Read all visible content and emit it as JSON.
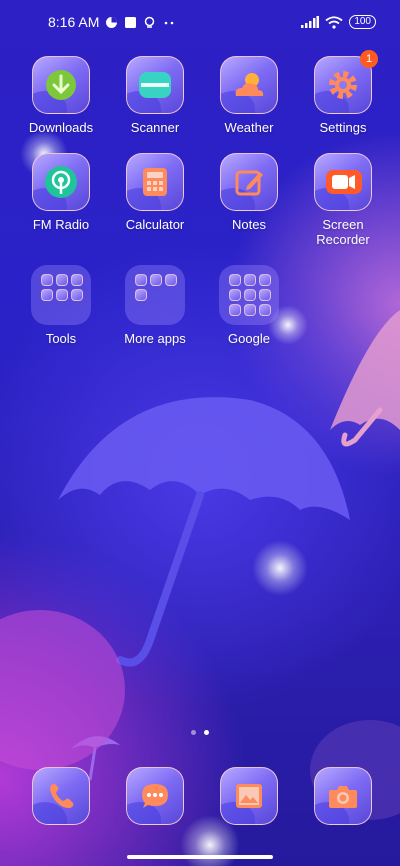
{
  "status_bar": {
    "time": "8:16 AM",
    "battery": "100",
    "icons": [
      "data-saver-icon",
      "square-notification-icon",
      "location-pin-icon",
      "more-dots-icon",
      "signal-bars-icon",
      "wifi-icon",
      "battery-icon"
    ]
  },
  "apps": [
    {
      "label": "Downloads",
      "icon": "download-arrow-icon"
    },
    {
      "label": "Scanner",
      "icon": "scanner-icon"
    },
    {
      "label": "Weather",
      "icon": "cloud-sun-icon"
    },
    {
      "label": "Settings",
      "icon": "gear-icon",
      "badge": "1"
    },
    {
      "label": "FM Radio",
      "icon": "radio-icon"
    },
    {
      "label": "Calculator",
      "icon": "calculator-icon"
    },
    {
      "label": "Notes",
      "icon": "note-pencil-icon"
    },
    {
      "label": "Screen\nRecorder",
      "icon": "video-camera-icon"
    }
  ],
  "folders": [
    {
      "label": "Tools",
      "items": 6
    },
    {
      "label": "More apps",
      "items": 4
    },
    {
      "label": "Google",
      "items": 9
    }
  ],
  "dock": [
    {
      "name": "phone",
      "icon": "phone-icon"
    },
    {
      "name": "messages",
      "icon": "chat-bubble-icon"
    },
    {
      "name": "gallery",
      "icon": "picture-icon"
    },
    {
      "name": "camera",
      "icon": "camera-icon"
    }
  ],
  "pages": {
    "count": 2,
    "active": 2
  },
  "colors": {
    "accent_orange": "#ff5a1f",
    "icon_stroke": "#ff8a5c",
    "badge": "#ff5a1f"
  }
}
